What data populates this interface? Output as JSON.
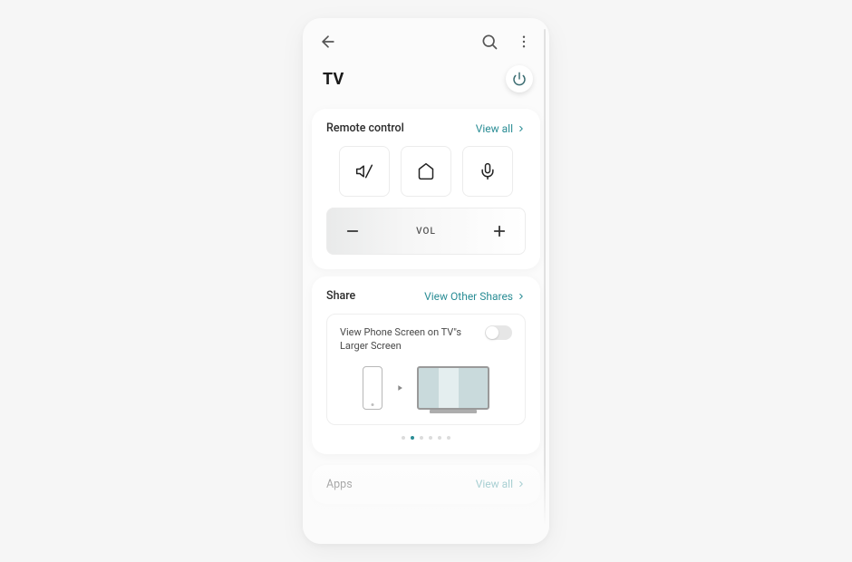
{
  "page": {
    "title": "TV"
  },
  "topbar": {
    "back": "back",
    "search": "search",
    "more": "more"
  },
  "remote": {
    "title": "Remote control",
    "view_all": "View all",
    "vol_label": "VOL"
  },
  "share": {
    "title": "Share",
    "view_other": "View Other Shares",
    "desc": "View Phone Screen on TV\"s Larger Screen"
  },
  "apps": {
    "title": "Apps",
    "view_all": "View all"
  },
  "pager": {
    "count": 6,
    "active": 1
  }
}
